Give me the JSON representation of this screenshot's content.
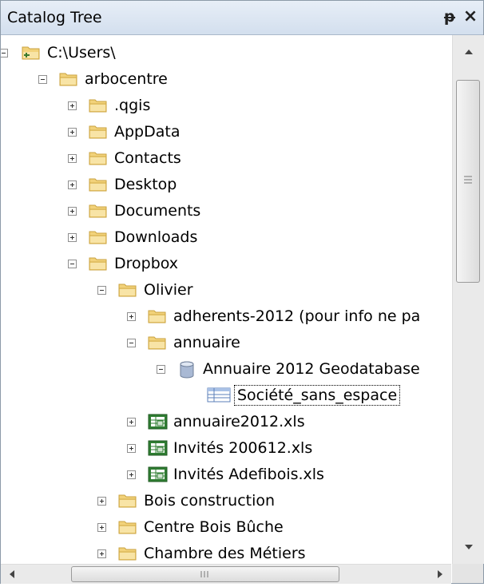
{
  "window": {
    "title": "Catalog Tree"
  },
  "tree": [
    {
      "label": "C:\\Users\\",
      "level": 0,
      "toggle": "minus",
      "icon": "folder-connection-icon"
    },
    {
      "label": "arbocentre",
      "level": 1,
      "toggle": "minus",
      "icon": "folder-icon"
    },
    {
      "label": ".qgis",
      "level": 2,
      "toggle": "plus",
      "icon": "folder-icon"
    },
    {
      "label": "AppData",
      "level": 2,
      "toggle": "plus",
      "icon": "folder-icon"
    },
    {
      "label": "Contacts",
      "level": 2,
      "toggle": "plus",
      "icon": "folder-icon"
    },
    {
      "label": "Desktop",
      "level": 2,
      "toggle": "plus",
      "icon": "folder-icon"
    },
    {
      "label": "Documents",
      "level": 2,
      "toggle": "plus",
      "icon": "folder-icon"
    },
    {
      "label": "Downloads",
      "level": 2,
      "toggle": "plus",
      "icon": "folder-icon"
    },
    {
      "label": "Dropbox",
      "level": 2,
      "toggle": "minus",
      "icon": "folder-icon"
    },
    {
      "label": "Olivier",
      "level": 3,
      "toggle": "minus",
      "icon": "folder-icon"
    },
    {
      "label": "adherents-2012 (pour info ne pa",
      "level": 4,
      "toggle": "plus",
      "icon": "folder-icon"
    },
    {
      "label": "annuaire",
      "level": 4,
      "toggle": "minus",
      "icon": "folder-icon"
    },
    {
      "label": "Annuaire 2012 Geodatabase",
      "level": 5,
      "toggle": "minus",
      "icon": "geodatabase-icon"
    },
    {
      "label": "Société_sans_espace",
      "level": 6,
      "toggle": "none",
      "icon": "table-icon",
      "selected": true
    },
    {
      "label": "annuaire2012.xls",
      "level": 4,
      "toggle": "plus",
      "icon": "excel-file-icon"
    },
    {
      "label": "Invités 200612.xls",
      "level": 4,
      "toggle": "plus",
      "icon": "excel-file-icon"
    },
    {
      "label": "Invités Adefibois.xls",
      "level": 4,
      "toggle": "plus",
      "icon": "excel-file-icon"
    },
    {
      "label": "Bois construction",
      "level": 3,
      "toggle": "plus",
      "icon": "folder-icon"
    },
    {
      "label": "Centre Bois Bûche",
      "level": 3,
      "toggle": "plus",
      "icon": "folder-icon"
    },
    {
      "label": "Chambre des Métiers",
      "level": 3,
      "toggle": "plus",
      "icon": "folder-icon"
    }
  ],
  "colors": {
    "folder": "#f2d27a",
    "folder_edge": "#c9a23f",
    "titlebar": "#dbe5f1"
  }
}
